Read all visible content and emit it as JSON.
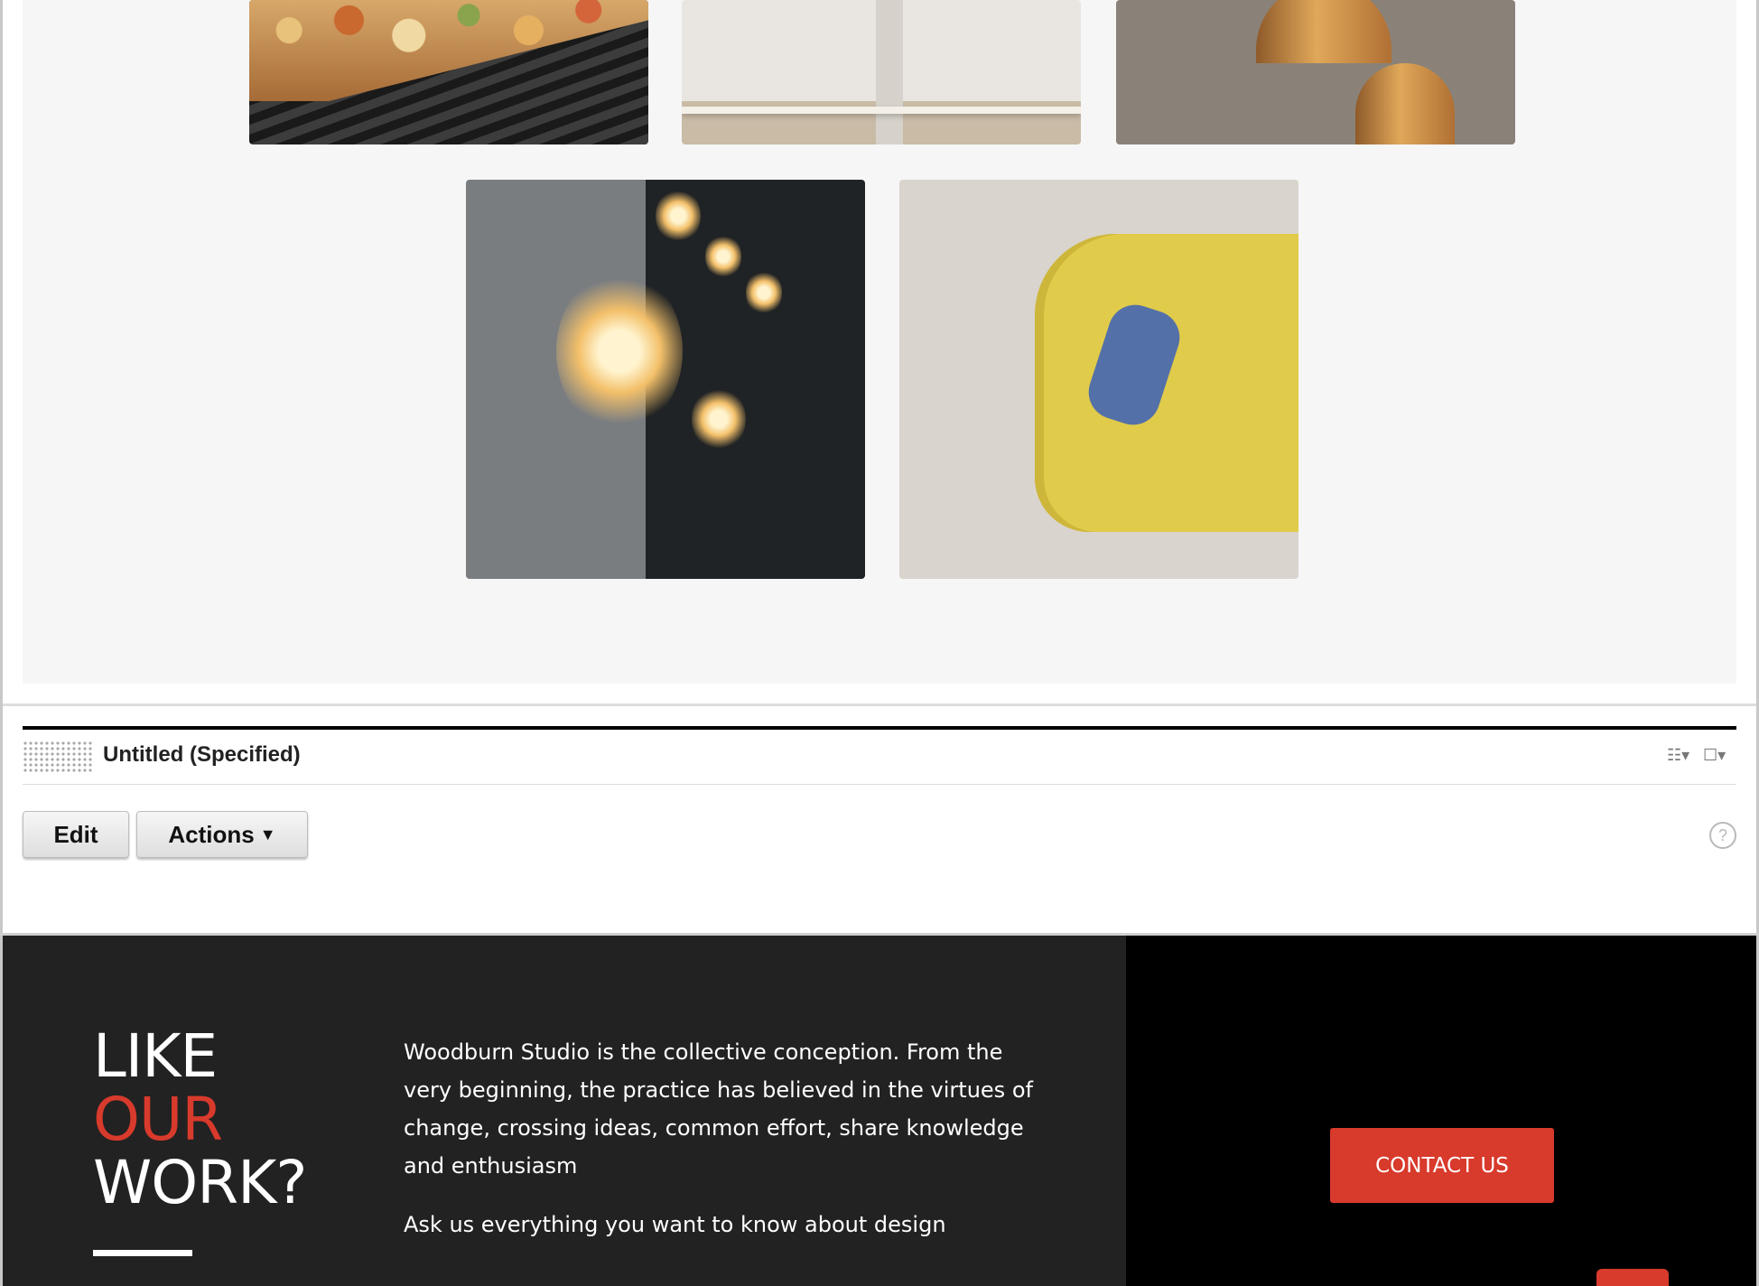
{
  "portlet": {
    "title": "Untitled (Specified)",
    "edit_label": "Edit",
    "actions_label": "Actions",
    "help_glyph": "?",
    "icons": [
      "layout-menu-icon",
      "window-menu-icon"
    ]
  },
  "footer": {
    "line1": "LIKE",
    "line2": "OUR",
    "line3": "WORK?",
    "paragraph": "Woodburn Studio is the collective conception. From the very beginning, the practice has believed in the virtues of change, crossing ideas, common effort, share knowledge and enthusiasm",
    "paragraph2": "Ask us everything you want to know about design",
    "contact_label": "CONTACT US"
  },
  "colors": {
    "accent": "#d83a2c",
    "footer_dark": "#222222",
    "footer_black": "#000000",
    "gallery_bg": "#f6f6f6"
  },
  "gallery": {
    "images": [
      "grill-food-photo",
      "kitchen-shelf-photo",
      "copper-pendant-lamps-photo",
      "cafe-hanging-bulbs-photo",
      "yellow-sofa-photo"
    ]
  }
}
